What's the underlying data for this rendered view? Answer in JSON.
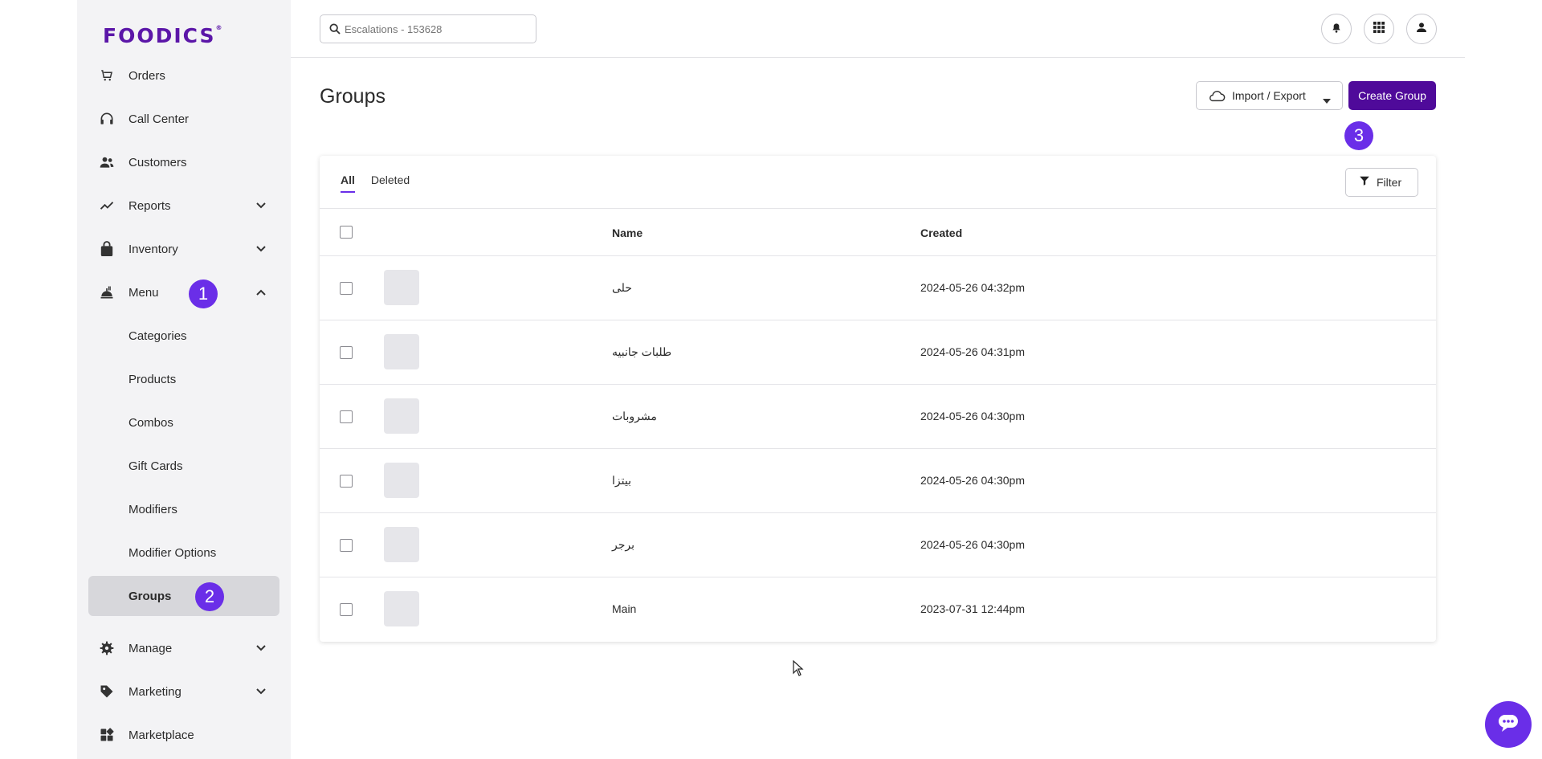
{
  "brand": {
    "logo": "FOODICS",
    "trademark": "®"
  },
  "search": {
    "placeholder": "Escalations - 153628"
  },
  "sidebar": {
    "items": [
      {
        "label": "Orders",
        "icon": "cart-icon"
      },
      {
        "label": "Call Center",
        "icon": "headset-icon"
      },
      {
        "label": "Customers",
        "icon": "users-icon"
      },
      {
        "label": "Reports",
        "icon": "trend-icon"
      },
      {
        "label": "Inventory",
        "icon": "bag-icon"
      },
      {
        "label": "Menu",
        "icon": "menu-food-icon"
      }
    ],
    "menu_sub": [
      {
        "label": "Categories"
      },
      {
        "label": "Products"
      },
      {
        "label": "Combos"
      },
      {
        "label": "Gift Cards"
      },
      {
        "label": "Modifiers"
      },
      {
        "label": "Modifier Options"
      },
      {
        "label": "Groups"
      }
    ],
    "bottom": [
      {
        "label": "Manage",
        "icon": "gear-icon"
      },
      {
        "label": "Marketing",
        "icon": "tag-icon"
      },
      {
        "label": "Marketplace",
        "icon": "apps-icon"
      }
    ]
  },
  "badges": {
    "one": "1",
    "two": "2",
    "three": "3"
  },
  "page": {
    "title": "Groups",
    "import_export_label": "Import / Export",
    "create_label": "Create Group",
    "filter_label": "Filter"
  },
  "tabs": [
    {
      "label": "All"
    },
    {
      "label": "Deleted"
    }
  ],
  "table": {
    "columns": {
      "name": "Name",
      "created": "Created"
    },
    "rows": [
      {
        "name": "حلى",
        "created": "2024-05-26 04:32pm"
      },
      {
        "name": "طلبات جانبيه",
        "created": "2024-05-26 04:31pm"
      },
      {
        "name": "مشروبات",
        "created": "2024-05-26 04:30pm"
      },
      {
        "name": "بيتزا",
        "created": "2024-05-26 04:30pm"
      },
      {
        "name": "برجر",
        "created": "2024-05-26 04:30pm"
      },
      {
        "name": "Main",
        "created": "2023-07-31 12:44pm"
      }
    ]
  },
  "colors": {
    "brand": "#5b16a8",
    "accent": "#6a2ee8",
    "primary_button": "#4f0a9a"
  }
}
